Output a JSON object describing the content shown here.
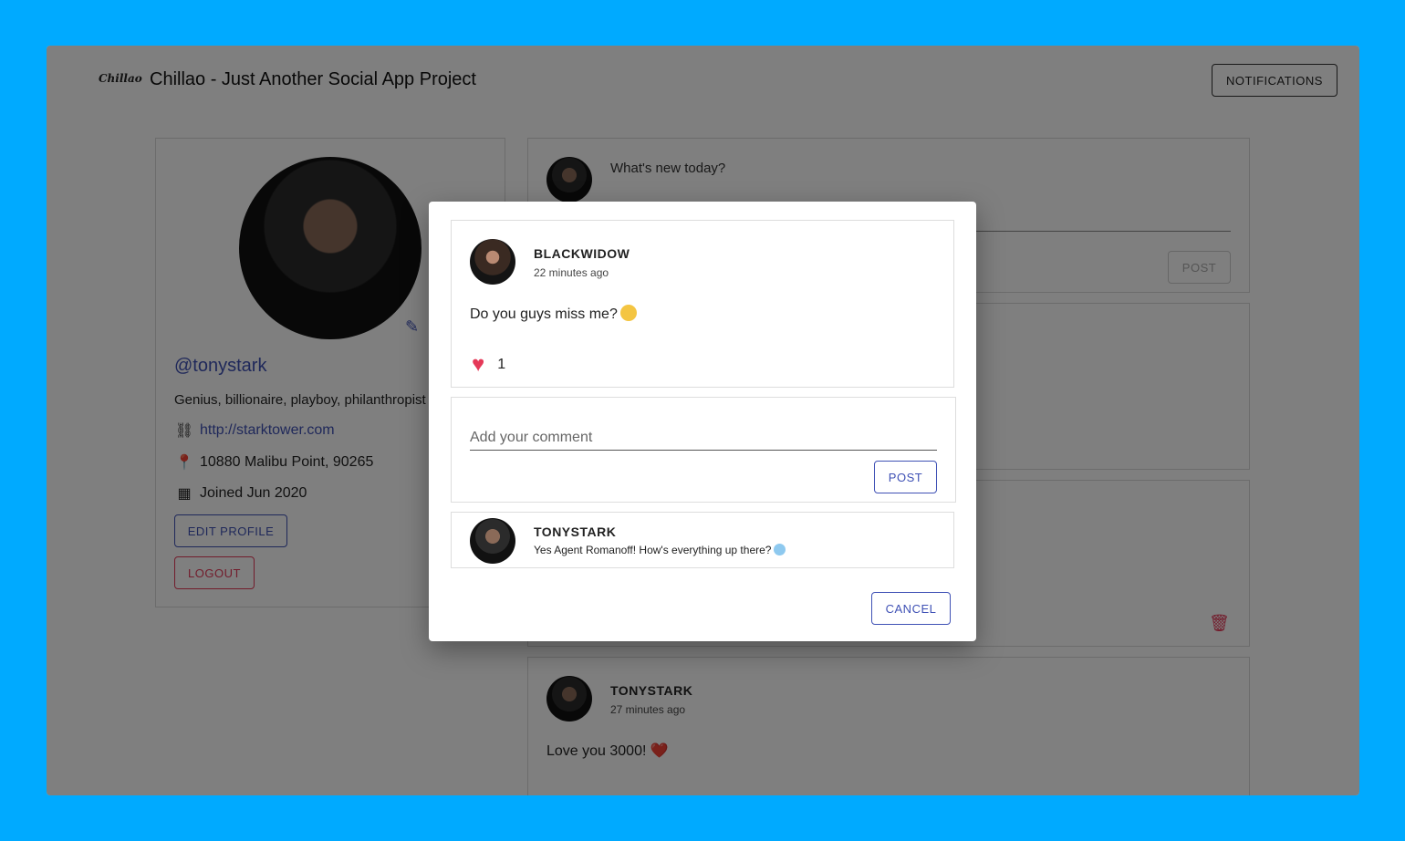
{
  "header": {
    "logo_text": "Chillao",
    "title": "Chillao - Just Another Social App Project",
    "notifications_label": "NOTIFICATIONS"
  },
  "profile": {
    "handle": "@tonystark",
    "bio": "Genius, billionaire, playboy, philanthropist",
    "website": "http://starktower.com",
    "location": "10880 Malibu Point, 90265",
    "joined": "Joined Jun 2020",
    "edit_label": "EDIT PROFILE",
    "logout_label": "LOGOUT"
  },
  "new_post": {
    "placeholder": "What's new today?",
    "post_label": "POST"
  },
  "background_posts": [
    {
      "user": "TONYSTARK",
      "time": "27 minutes ago",
      "body": "Love you 3000! ❤️"
    }
  ],
  "dialog": {
    "post": {
      "user": "BLACKWIDOW",
      "time": "22 minutes ago",
      "body": "Do you guys miss me?",
      "likes": "1"
    },
    "comment_placeholder": "Add your comment",
    "comment_post_label": "POST",
    "comments": [
      {
        "user": "TONYSTARK",
        "text": "Yes Agent Romanoff! How's everything up there?"
      }
    ],
    "cancel_label": "CANCEL"
  },
  "colors": {
    "page_bg": "#00aaff",
    "accent": "#3f51b5",
    "danger": "#e53958",
    "overlay": "rgba(0,0,0,0.5)"
  },
  "icons": [
    "pencil-icon",
    "link-icon",
    "location-icon",
    "calendar-icon",
    "trash-icon",
    "heart-icon"
  ]
}
